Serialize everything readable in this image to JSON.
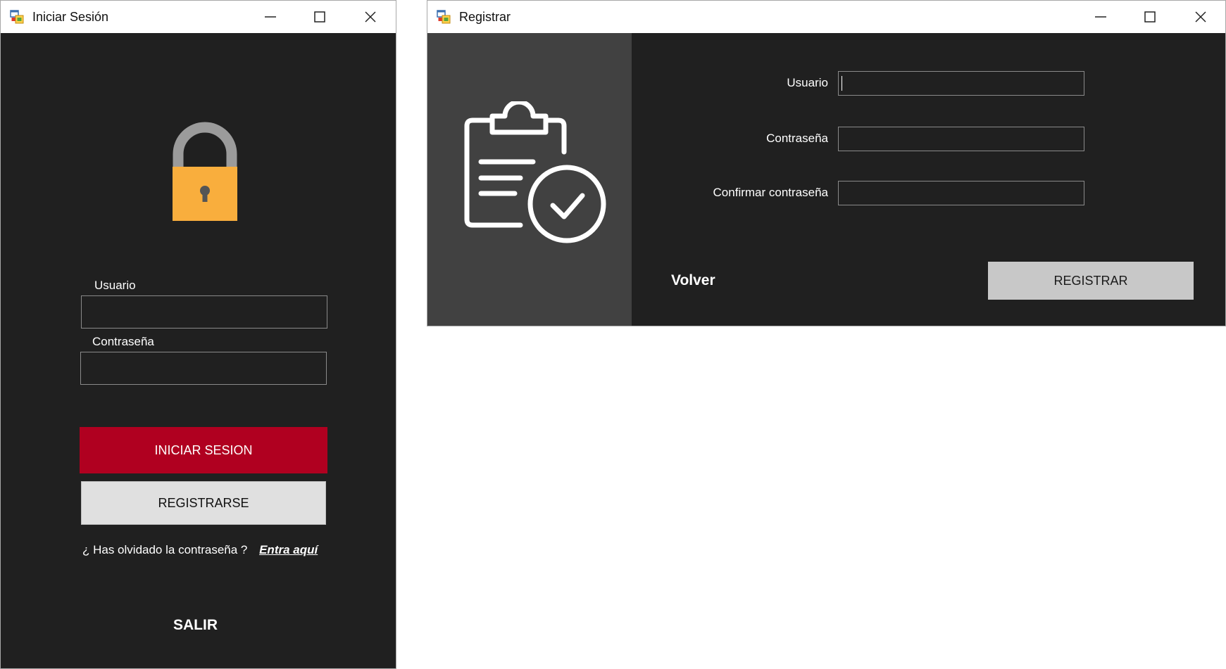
{
  "login_window": {
    "title": "Iniciar Sesión",
    "app_icon": "winforms-app-icon",
    "controls": [
      "minimize-icon",
      "maximize-icon",
      "close-icon"
    ],
    "hero_icon": "padlock-icon",
    "usuario_label": "Usuario",
    "usuario_value": "",
    "contrasena_label": "Contraseña",
    "contrasena_value": "",
    "login_button": "INICIAR SESION",
    "register_button": "REGISTRARSE",
    "forgot_text": "¿ Has olvidado la contraseña ?",
    "forgot_link": "Entra aquí",
    "exit_link": "SALIR"
  },
  "register_window": {
    "title": "Registrar",
    "app_icon": "winforms-app-icon",
    "controls": [
      "minimize-icon",
      "maximize-icon",
      "close-icon"
    ],
    "side_icon": "clipboard-check-icon",
    "usuario_label": "Usuario",
    "usuario_value": "",
    "contrasena_label": "Contraseña",
    "contrasena_value": "",
    "confirmar_label": "Confirmar contraseña",
    "confirmar_value": "",
    "back_link": "Volver",
    "register_button": "REGISTRAR"
  },
  "colors": {
    "form_background": "#202020",
    "side_panel": "#414141",
    "primary_button": "#b00020",
    "secondary_button": "#e0e0e0",
    "register_button": "#c8c8c8",
    "lock_body": "#f9ae3d",
    "lock_shackle": "#9b9b9b"
  }
}
